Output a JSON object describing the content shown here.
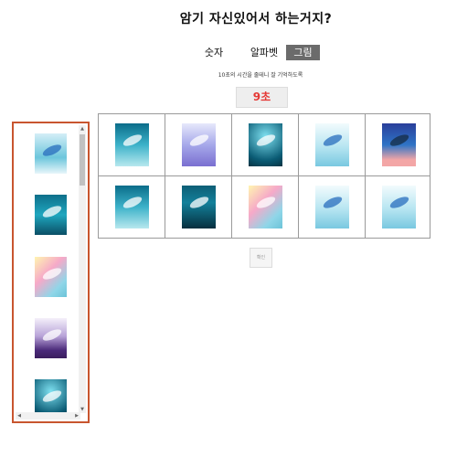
{
  "title": "암기 자신있어서 하는거지?",
  "tabs": [
    {
      "label": "숫자",
      "active": false
    },
    {
      "label": "알파벳",
      "active": false
    },
    {
      "label": "그림",
      "active": true
    }
  ],
  "hint": "10초의 시간을 줄테니 잘 기억하도록",
  "timer": "9초",
  "done_button": "확인",
  "colors": {
    "accent_timer": "#e53935",
    "sidebar_border": "#c8552f",
    "active_tab": "#6b6b6b"
  },
  "sidebar_images": [
    {
      "name": "whale-light-painting",
      "style": "lightblue"
    },
    {
      "name": "whale-teal-painting",
      "style": "teal"
    },
    {
      "name": "whale-pastel-painting",
      "style": "pastel"
    },
    {
      "name": "whale-purple-painting",
      "style": "purple"
    },
    {
      "name": "whale-deep-painting",
      "style": "deep"
    }
  ],
  "grid_images": [
    [
      {
        "name": "whale-sea-painting",
        "style": "sea"
      },
      {
        "name": "whale-violet-painting",
        "style": "violet"
      },
      {
        "name": "whale-deep-painting",
        "style": "deep"
      },
      {
        "name": "whale-ice-painting",
        "style": "icewhale"
      },
      {
        "name": "whale-navy-painting",
        "style": "navy"
      }
    ],
    [
      {
        "name": "whale-sea-painting",
        "style": "sea"
      },
      {
        "name": "whale-abyss-painting",
        "style": "abyss"
      },
      {
        "name": "whale-pastel-painting",
        "style": "pastel"
      },
      {
        "name": "whale-ice-painting",
        "style": "icewhale"
      },
      {
        "name": "whale-ice-painting",
        "style": "icewhale"
      }
    ]
  ]
}
